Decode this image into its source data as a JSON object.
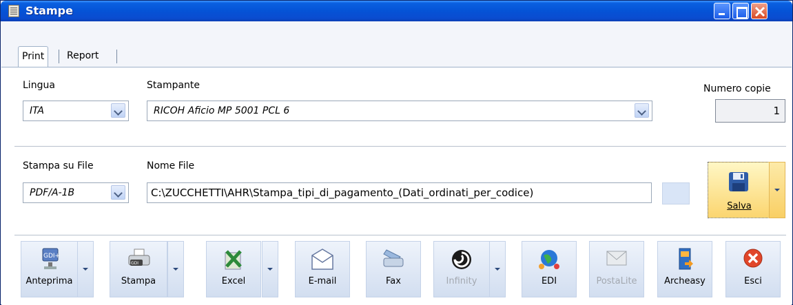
{
  "window": {
    "title": "Stampe"
  },
  "tabs": [
    {
      "label": "Print"
    },
    {
      "label": "Report"
    }
  ],
  "print": {
    "lingua": {
      "label": "Lingua",
      "value": "ITA"
    },
    "stampante": {
      "label": "Stampante",
      "value": "RICOH Aficio MP 5001 PCL 6"
    },
    "numero_copie": {
      "label": "Numero copie",
      "value": "1"
    },
    "stampa_su_file": {
      "label": "Stampa su File",
      "value": "PDF/A-1B"
    },
    "nome_file": {
      "label": "Nome File",
      "value": "C:\\ZUCCHETTI\\AHR\\Stampa_tipi_di_pagamento_(Dati_ordinati_per_codice)"
    },
    "salva_label": "Salva"
  },
  "toolbar": {
    "anteprima": "Anteprima",
    "stampa": "Stampa",
    "excel": "Excel",
    "email": "E-mail",
    "fax": "Fax",
    "infinity": "Infinity",
    "edi": "EDI",
    "postalite": "PostaLite",
    "archeasy": "Archeasy",
    "esci": "Esci"
  },
  "icons": {
    "anteprima": "gdi-plus-monitor-icon",
    "stampa": "gdi-printer-icon",
    "excel": "excel-icon",
    "email": "envelope-icon",
    "fax": "fax-icon",
    "infinity": "infinity-swirl-icon",
    "edi": "globe-people-icon",
    "postalite": "postalite-envelope-icon",
    "archeasy": "archeasy-icon",
    "esci": "close-x-icon",
    "salva": "floppy-disk-icon"
  }
}
